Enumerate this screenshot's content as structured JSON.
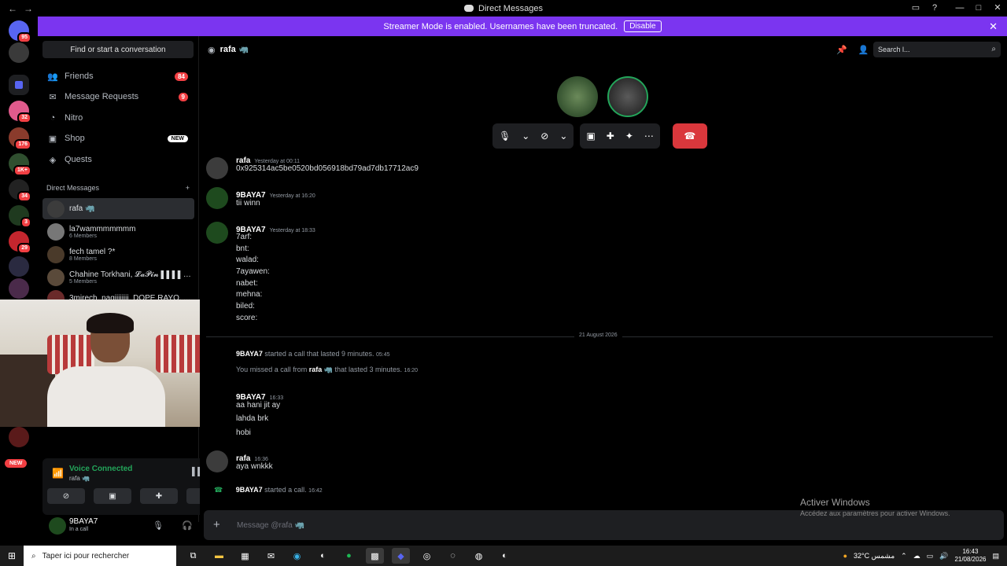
{
  "window": {
    "title": "Direct Messages",
    "controls": [
      "—",
      "□",
      "✕"
    ]
  },
  "banner": {
    "text": "Streamer Mode is enabled. Usernames have been truncated.",
    "disable_label": "Disable"
  },
  "guilds": {
    "badges": [
      "95",
      "32",
      "176",
      "1K+",
      "34",
      "3",
      "29"
    ],
    "new_label": "NEW"
  },
  "sidebar": {
    "find_label": "Find or start a conversation",
    "nav": [
      {
        "label": "Friends",
        "icon": "friends-icon",
        "count": "84"
      },
      {
        "label": "Message Requests",
        "icon": "mail-icon",
        "count": "9"
      },
      {
        "label": "Nitro",
        "icon": "nitro-icon"
      },
      {
        "label": "Shop",
        "icon": "shop-icon",
        "tag": "NEW"
      },
      {
        "label": "Quests",
        "icon": "quests-icon"
      }
    ],
    "dm_header": "Direct Messages",
    "dms": [
      {
        "name": "rafa 🦏",
        "sub": ""
      },
      {
        "name": "la7wammmmmmm",
        "sub": "6 Members"
      },
      {
        "name": "fech tamel ?*",
        "sub": "8 Members"
      },
      {
        "name": "Chahine Torkhani, 𝓛𝓪𝓟𝓲𝓷 ▌▌▌▌▌▌...",
        "sub": "5 Members"
      },
      {
        "name": "3mirech, nagiiiiiiii, DOPE RAYO, ...",
        "sub": ""
      }
    ]
  },
  "voice": {
    "status": "Voice Connected",
    "channel": "rafa 🦏"
  },
  "user": {
    "name": "9BAYA7",
    "status": "In a call"
  },
  "channel": {
    "name": "rafa",
    "search_placeholder": "Search l..."
  },
  "messages": {
    "m0": {
      "author": "rafa",
      "ts": "Yesterday at 00:11",
      "line1": "0x925314ac5be0520bd056918bd79ad7db17712ac9"
    },
    "m1": {
      "author": "9BAYA7",
      "ts": "Yesterday at 16:20",
      "line1": "tii winn"
    },
    "m2": {
      "author": "9BAYA7",
      "ts": "Yesterday at 18:33",
      "lines": [
        "7arf:",
        "bnt:",
        "walad:",
        "7ayawen:",
        "nabet:",
        "mehna:",
        "biled:",
        "score:"
      ]
    },
    "date_divider": "21 August 2026",
    "sys1": {
      "actor": "9BAYA7",
      "text": "started a call that lasted 9 minutes.",
      "ts": "05:45"
    },
    "sys2": {
      "pre": "You missed a call from",
      "actor": "rafa 🦏",
      "text": "that lasted 3 minutes.",
      "ts": "16:20"
    },
    "m3": {
      "author": "9BAYA7",
      "ts": "16:33",
      "lines": [
        "aa hani jit ay",
        "lahda brk",
        "hobi"
      ]
    },
    "m4": {
      "author": "rafa",
      "ts": "16:36",
      "line1": "aya wnkkk"
    },
    "sys3": {
      "actor": "9BAYA7",
      "text": "started a call.",
      "ts": "16:42"
    }
  },
  "composer": {
    "placeholder": "Message @rafa 🦏"
  },
  "watermark": {
    "line1": "Activer Windows",
    "line2": "Accédez aux paramètres pour activer Windows."
  },
  "taskbar": {
    "search_placeholder": "Taper ici pour rechercher",
    "weather": "32°C مشمس",
    "time": "16:43",
    "date": "21/08/2026"
  },
  "colors": {
    "banner": "#7b35f0",
    "hangup": "#da373c",
    "voice_green": "#23a55a",
    "badge_red": "#f23f43"
  }
}
